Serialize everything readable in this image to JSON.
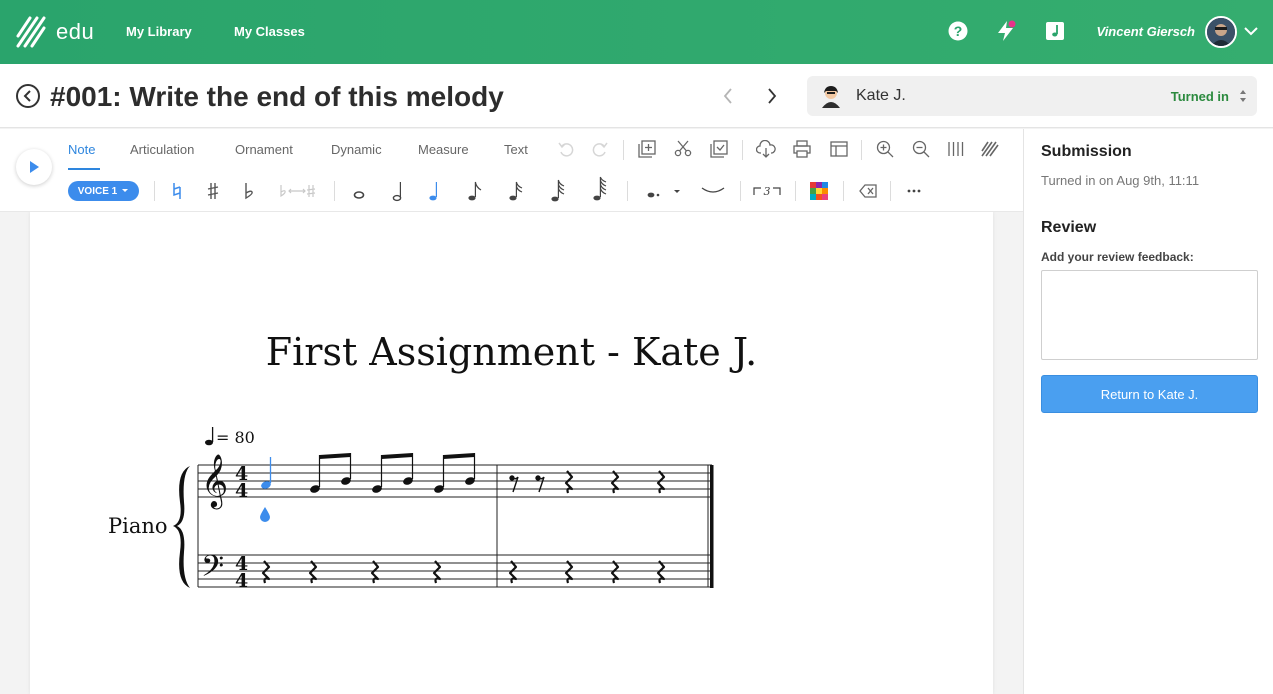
{
  "topbar": {
    "logo_text": "edu",
    "nav": [
      "My Library",
      "My Classes"
    ],
    "user_name": "Vincent Giersch"
  },
  "header": {
    "title": "#001: Write the end of this melody",
    "student_name": "Kate J.",
    "status": "Turned in"
  },
  "toolbar": {
    "tabs": [
      "Note",
      "Articulation",
      "Ornament",
      "Dynamic",
      "Measure",
      "Text"
    ],
    "active_tab": "Note",
    "voice_label": "VOICE 1",
    "tuplet_label": "3"
  },
  "score": {
    "title": "First Assignment - Kate J.",
    "instrument": "Piano",
    "tempo": "= 80",
    "time_signature": "4/4"
  },
  "side": {
    "submission_title": "Submission",
    "submission_text": "Turned in on Aug 9th, 11:11",
    "review_title": "Review",
    "feedback_label": "Add your review feedback:",
    "feedback_value": "",
    "return_button": "Return to Kate J."
  },
  "colors": {
    "brand": "#2aa46c",
    "accent": "#3c8cec",
    "status": "#2b8a3e"
  }
}
